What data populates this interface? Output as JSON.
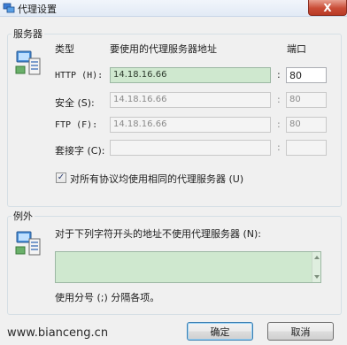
{
  "window": {
    "title": "代理设置",
    "close_glyph": "X"
  },
  "servers": {
    "legend": "服务器",
    "col_type": "类型",
    "col_address": "要使用的代理服务器地址",
    "col_port": "端口",
    "rows": [
      {
        "label": "HTTP (H):",
        "address": "14.18.16.66",
        "port": "80",
        "enabled": true
      },
      {
        "label": "安全 (S):",
        "address": "14.18.16.66",
        "port": "80",
        "enabled": false
      },
      {
        "label": "FTP (F):",
        "address": "14.18.16.66",
        "port": "80",
        "enabled": false
      },
      {
        "label": "套接字 (C):",
        "address": "",
        "port": "",
        "enabled": false
      }
    ],
    "colon": ":",
    "same_proxy_label": "对所有协议均使用相同的代理服务器 (U)",
    "same_proxy_checked": true
  },
  "exceptions": {
    "legend": "例外",
    "instruction": "对于下列字符开头的地址不使用代理服务器 (N):",
    "value": "",
    "hint": "使用分号 (;) 分隔各项。"
  },
  "buttons": {
    "ok": "确定",
    "cancel": "取消"
  },
  "watermark": "www.bianceng.cn"
}
